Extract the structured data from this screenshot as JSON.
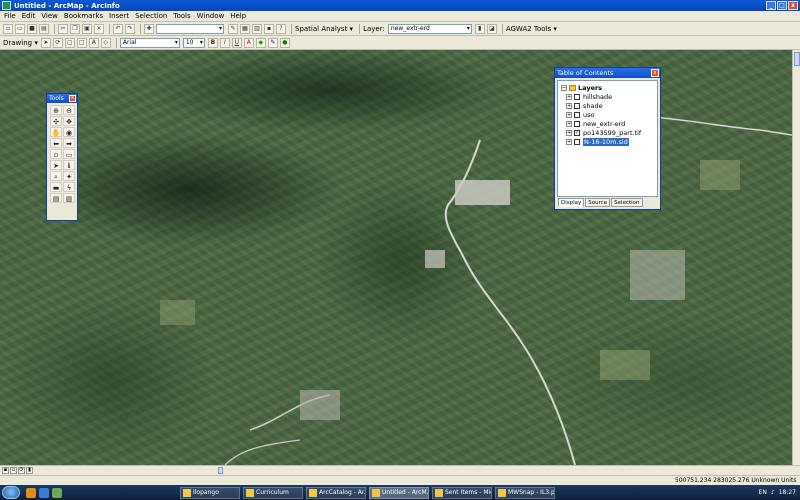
{
  "window": {
    "title": "Untitled - ArcMap - ArcInfo",
    "buttons": [
      "_",
      "□",
      "x"
    ]
  },
  "menu": [
    "File",
    "Edit",
    "View",
    "Bookmarks",
    "Insert",
    "Selection",
    "Tools",
    "Window",
    "Help"
  ],
  "toolbar1": {
    "spatial_analyst": "Spatial Analyst ▾",
    "layer_label": "Layer:",
    "layer_value": "new_extr-erd",
    "agwa": "AGWA2 Tools ▾"
  },
  "toolbar2": {
    "drawing": "Drawing ▾",
    "font": "Arial",
    "size": "10",
    "bold": "B",
    "italic": "I",
    "underline": "U"
  },
  "tools_window": {
    "title": "Tools"
  },
  "toc": {
    "title": "Table of Contents",
    "root": "Layers",
    "layers": [
      {
        "name": "hillshade",
        "checked": false
      },
      {
        "name": "shade",
        "checked": false
      },
      {
        "name": "uso",
        "checked": false
      },
      {
        "name": "new_extr-erd",
        "checked": false
      },
      {
        "name": "po143599_part.tif",
        "checked": true
      },
      {
        "name": "N-16-10m.sid",
        "checked": false
      }
    ],
    "tabs": [
      "Display",
      "Source",
      "Selection"
    ]
  },
  "status": {
    "coordinates": "500751.234  283025.276 Unknown Units"
  },
  "taskbar": {
    "tasks": [
      "Ilopango",
      "Curriculum",
      "ArcCatalog - Ar...",
      "Untitled - ArcM...",
      "Sent Items - Mic...",
      "MWSnap - IL3.p..."
    ],
    "tray_lang": "EN",
    "clock": "18:27"
  }
}
